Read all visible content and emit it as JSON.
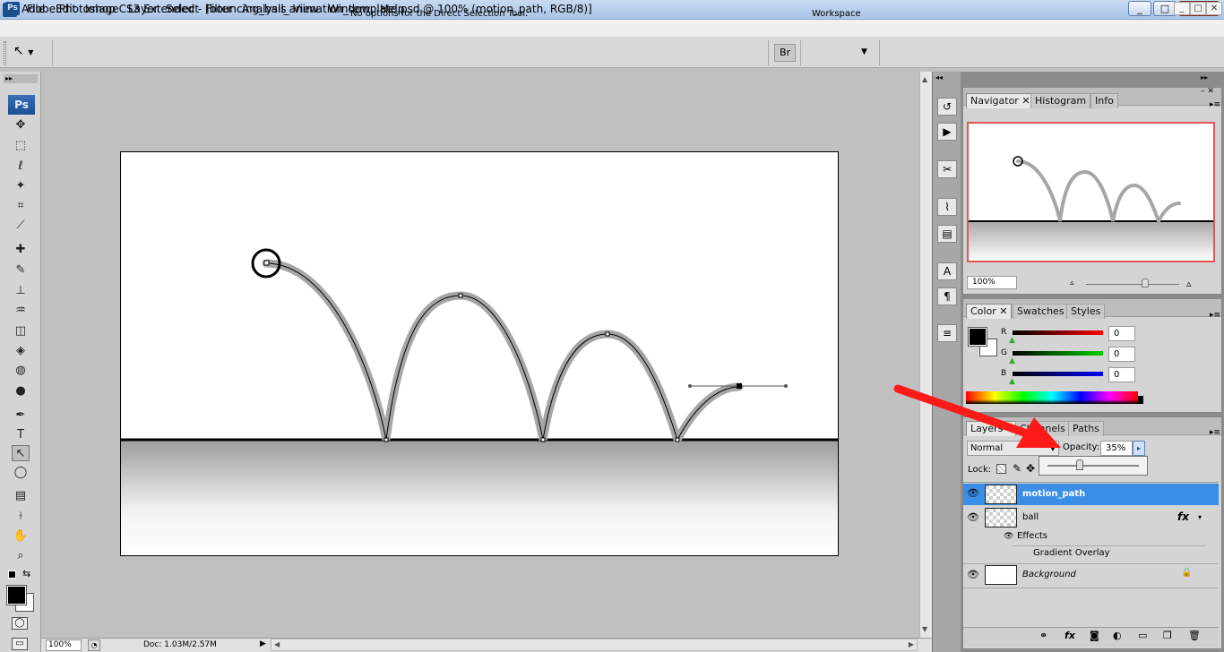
{
  "window": {
    "title": "Adobe Photoshop CS3 Extended - [bouncing_ball_animation_template.psd @ 100% (motion_path, RGB/8)]",
    "app_icon": "Ps",
    "controls": [
      "_",
      "□",
      "✕"
    ],
    "mdi_controls": [
      "_",
      "□",
      "✕"
    ]
  },
  "menu": [
    "File",
    "Edit",
    "Image",
    "Layer",
    "Select",
    "Filter",
    "Analysis",
    "View",
    "Window",
    "Help"
  ],
  "options_bar": {
    "message": "No options for the Direct Selection Tool.",
    "workspace_label": "Workspace"
  },
  "toolbox": {
    "logo": "Ps",
    "selected_tool": "direct-selection-tool",
    "tools": [
      {
        "name": "move-tool-icon",
        "glyph": "✥"
      },
      {
        "name": "marquee-tool-icon",
        "glyph": "⬚"
      },
      {
        "name": "lasso-tool-icon",
        "glyph": "ℓ"
      },
      {
        "name": "magic-wand-tool-icon",
        "glyph": "✦"
      },
      {
        "name": "crop-tool-icon",
        "glyph": "⌗"
      },
      {
        "name": "slice-tool-icon",
        "glyph": "⟋"
      },
      {
        "name": "healing-brush-tool-icon",
        "glyph": "✚"
      },
      {
        "name": "brush-tool-icon",
        "glyph": "✎"
      },
      {
        "name": "clone-stamp-tool-icon",
        "glyph": "⊥"
      },
      {
        "name": "history-brush-tool-icon",
        "glyph": "♒"
      },
      {
        "name": "eraser-tool-icon",
        "glyph": "◫"
      },
      {
        "name": "paint-bucket-tool-icon",
        "glyph": "◈"
      },
      {
        "name": "blur-tool-icon",
        "glyph": "◍"
      },
      {
        "name": "dodge-tool-icon",
        "glyph": "●"
      },
      {
        "name": "pen-tool-icon",
        "glyph": "✒"
      },
      {
        "name": "type-tool-icon",
        "glyph": "T"
      },
      {
        "name": "direct-selection-tool-icon",
        "glyph": "↖"
      },
      {
        "name": "ellipse-tool-icon",
        "glyph": "◯"
      },
      {
        "name": "notes-tool-icon",
        "glyph": "▤"
      },
      {
        "name": "eyedropper-tool-icon",
        "glyph": "⟊"
      },
      {
        "name": "hand-tool-icon",
        "glyph": "✋"
      },
      {
        "name": "zoom-tool-icon",
        "glyph": "⌕"
      }
    ]
  },
  "status_bar": {
    "zoom": "100%",
    "doc": "Doc: 1.03M/2.57M"
  },
  "navigator_panel": {
    "tabs": [
      "Navigator",
      "Histogram",
      "Info"
    ],
    "active_tab": "Navigator",
    "zoom": "100%"
  },
  "color_panel": {
    "tabs": [
      "Color",
      "Swatches",
      "Styles"
    ],
    "active_tab": "Color",
    "channels": [
      {
        "label": "R",
        "value": "0",
        "color": "#ff0000"
      },
      {
        "label": "G",
        "value": "0",
        "color": "#00c000"
      },
      {
        "label": "B",
        "value": "0",
        "color": "#0000ff"
      }
    ],
    "foreground": "#000000",
    "background": "#ffffff"
  },
  "layers_panel": {
    "tabs": [
      "Layers",
      "Channels",
      "Paths"
    ],
    "active_tab": "Layers",
    "blend_mode": "Normal",
    "opacity_label": "Opacity:",
    "opacity_value": "35%",
    "opacity_fraction": 0.35,
    "lock_label": "Lock:",
    "layers": [
      {
        "name": "motion_path",
        "selected": true,
        "visible": true
      },
      {
        "name": "ball",
        "selected": false,
        "visible": true,
        "fx": "fx"
      },
      {
        "name": "Background",
        "selected": false,
        "visible": true,
        "locked": true
      }
    ],
    "effects_label": "Effects",
    "effect_name": "Gradient Overlay"
  },
  "annotation": {
    "arrow_color": "#ff1a1a"
  }
}
